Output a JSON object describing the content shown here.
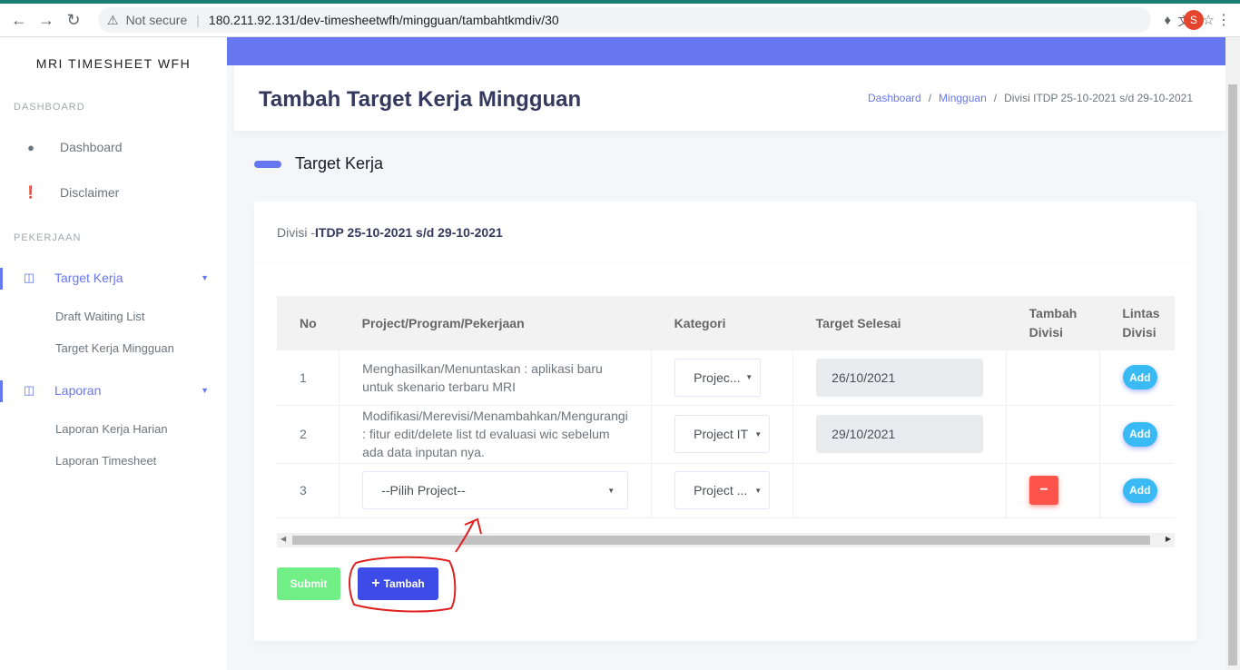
{
  "browser": {
    "security_label": "Not secure",
    "url": "180.211.92.131/dev-timesheetwfh/mingguan/tambahtkmdiv/30",
    "profile_initial": "S"
  },
  "sidebar": {
    "brand": "MRI TIMESHEET WFH",
    "header_dashboard": "DASHBOARD",
    "item_dashboard": "Dashboard",
    "item_disclaimer": "Disclaimer",
    "header_pekerjaan": "PEKERJAAN",
    "item_target_kerja": "Target Kerja",
    "sub_draft": "Draft Waiting List",
    "sub_target_mingguan": "Target Kerja Mingguan",
    "item_laporan": "Laporan",
    "sub_laporan_harian": "Laporan Kerja Harian",
    "sub_laporan_timesheet": "Laporan Timesheet"
  },
  "header": {
    "title": "Tambah Target Kerja Mingguan",
    "breadcrumb_1": "Dashboard",
    "breadcrumb_2": "Mingguan",
    "breadcrumb_3": "Divisi ITDP 25-10-2021 s/d 29-10-2021"
  },
  "section": {
    "title": "Target Kerja"
  },
  "card": {
    "prefix": "Divisi -",
    "heading": "ITDP 25-10-2021 s/d 29-10-2021"
  },
  "table": {
    "col_no": "No",
    "col_project": "Project/Program/Pekerjaan",
    "col_kategori": "Kategori",
    "col_target": "Target Selesai",
    "col_tambah_1": "Tambah",
    "col_tambah_2": "Divisi",
    "col_lintas_1": "Lintas",
    "col_lintas_2": "Divisi",
    "rows": [
      {
        "no": "1",
        "project": "Menghasilkan/Menuntaskan : aplikasi baru untuk skenario terbaru MRI",
        "kategori": "Projec...",
        "target": "26/10/2021",
        "add": "Add"
      },
      {
        "no": "2",
        "project": "Modifikasi/Merevisi/Menambahkan/Mengurangi : fitur edit/delete list td evaluasi wic sebelum ada data inputan nya.",
        "kategori": "Project IT",
        "target": "29/10/2021",
        "add": "Add"
      },
      {
        "no": "3",
        "project": "--Pilih Project--",
        "kategori": "Project ...",
        "target": "",
        "remove": "−",
        "add": "Add"
      }
    ]
  },
  "actions": {
    "submit": "Submit",
    "tambah": "Tambah"
  },
  "colors": {
    "primary": "#6777ef",
    "info": "#3abaf4",
    "danger": "#fc544b",
    "success": "#63ed7a",
    "annotation": "#e02020"
  }
}
